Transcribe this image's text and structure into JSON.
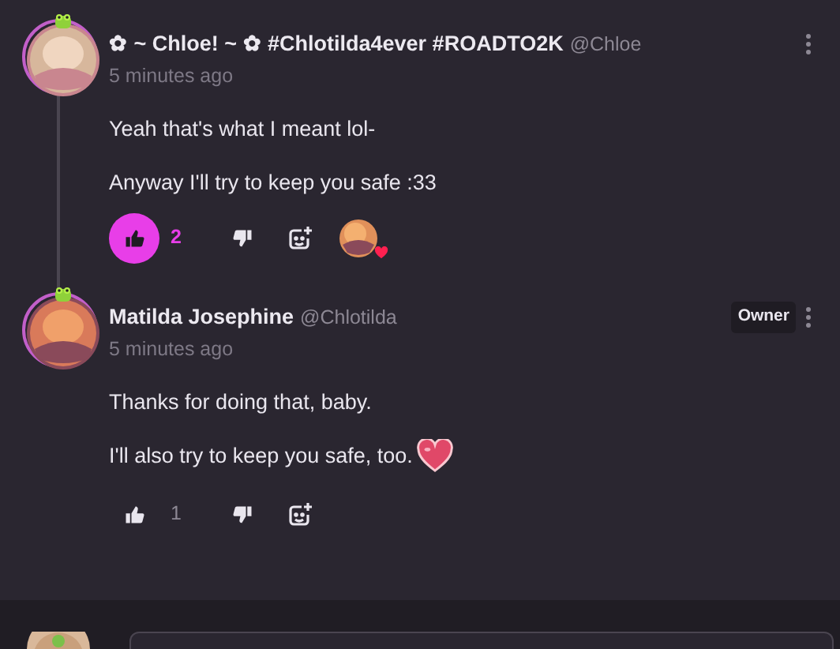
{
  "comments": [
    {
      "author": "✿ ~ Chloe! ~ ✿ #Chlotilda4ever #ROADTO2K",
      "handle": "@Chloe",
      "time": "5 minutes ago",
      "paragraphs": [
        {
          "kind": "plain",
          "text": "Yeah that's what I meant lol-"
        },
        {
          "kind": "plain",
          "text": "Anyway I'll try to keep you safe :33"
        }
      ],
      "liked": true,
      "likes": "2",
      "reactions": [
        {
          "kind": "heart"
        }
      ]
    },
    {
      "author": "Matilda Josephine",
      "handle": "@Chlotilda",
      "time": "5 minutes ago",
      "badge": "Owner",
      "paragraphs": [
        {
          "kind": "plain",
          "text": "Thanks for doing that, baby."
        },
        {
          "kind": "with_heart",
          "text": "I'll also try to keep you safe, too."
        }
      ],
      "liked": false,
      "likes": "1"
    }
  ]
}
